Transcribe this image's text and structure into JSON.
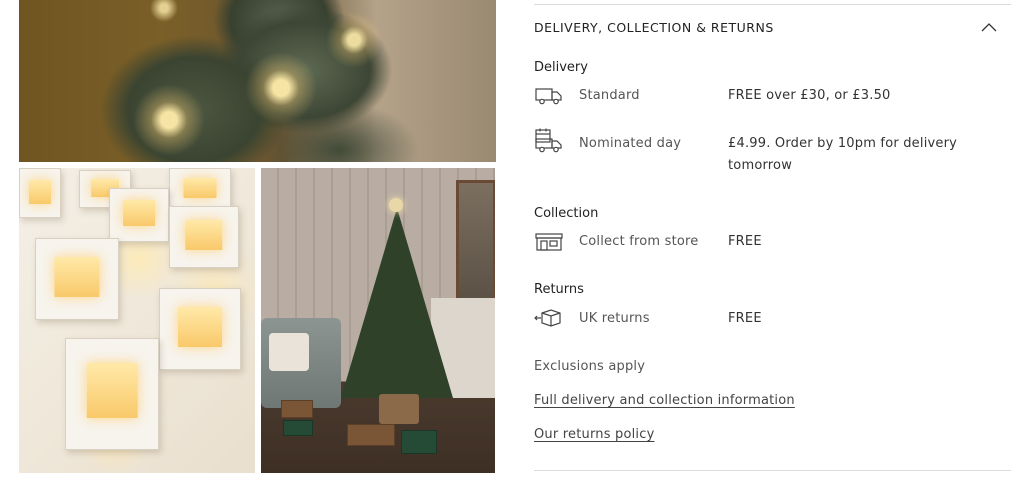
{
  "gallery": {
    "images": [
      {
        "name": "tree-lights-closeup-image"
      },
      {
        "name": "house-fairy-lights-image"
      },
      {
        "name": "living-room-tree-image"
      }
    ]
  },
  "delivery_panel": {
    "header_title": "DELIVERY, COLLECTION & RETURNS",
    "expanded": true,
    "delivery": {
      "heading": "Delivery",
      "options": [
        {
          "icon": "delivery-van-icon",
          "label": "Standard",
          "value": "FREE over £30, or £3.50"
        },
        {
          "icon": "calendar-van-icon",
          "label": "Nominated day",
          "value": "£4.99. Order by 10pm for delivery tomorrow"
        }
      ]
    },
    "collection": {
      "heading": "Collection",
      "options": [
        {
          "icon": "store-icon",
          "label": "Collect from store",
          "value": "FREE"
        }
      ]
    },
    "returns": {
      "heading": "Returns",
      "options": [
        {
          "icon": "return-parcel-icon",
          "label": "UK returns",
          "value": "FREE"
        }
      ]
    },
    "exclusions_note": "Exclusions apply",
    "links": {
      "full_delivery": "Full delivery and collection information",
      "returns_policy": "Our returns policy"
    }
  },
  "colors": {
    "text_primary": "#222222",
    "text_secondary": "#555555",
    "divider": "#dcdcdc"
  }
}
